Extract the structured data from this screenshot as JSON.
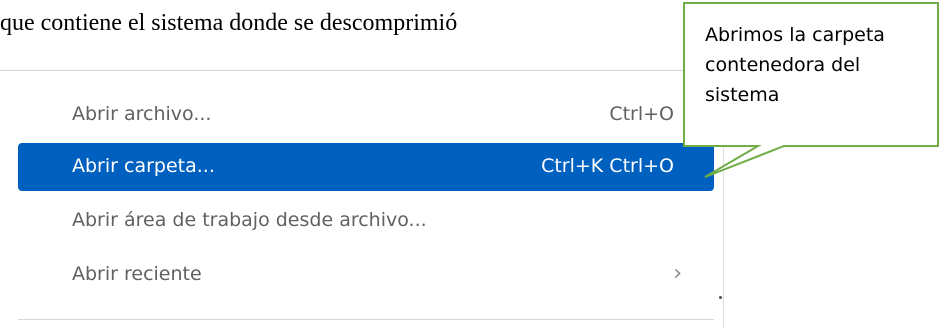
{
  "document": {
    "text": "que contiene el sistema donde se descomprimió"
  },
  "menu": {
    "items": [
      {
        "label": "Abrir archivo...",
        "shortcut": "Ctrl+O",
        "selected": false
      },
      {
        "label": "Abrir carpeta...",
        "shortcut": "Ctrl+K Ctrl+O",
        "selected": true
      },
      {
        "label": "Abrir área de trabajo desde archivo...",
        "shortcut": "",
        "selected": false
      },
      {
        "label": "Abrir reciente",
        "shortcut": "",
        "selected": false,
        "submenu_icon": "chevron-right-icon"
      }
    ]
  },
  "callout": {
    "lines": [
      "Abrimos la carpeta",
      "contenedora del",
      "sistema"
    ],
    "fill_color": "#ffffff",
    "border_color": "#70ad47"
  },
  "colors": {
    "selection": "#0060c0",
    "menu_text": "#616161"
  }
}
